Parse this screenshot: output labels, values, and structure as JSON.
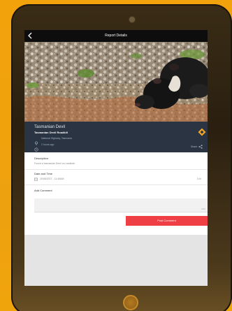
{
  "topbar": {
    "back_icon": "chevron-left-icon",
    "title": "Report Details"
  },
  "report": {
    "species": "Tasmanian Devil",
    "category": "Tasmanian Devil Roadkill",
    "location": "National Highway, Tasmania",
    "time_ago": "2 hours ago",
    "share_label": "Share",
    "warning_color": "#f5a623"
  },
  "description": {
    "label": "Description",
    "value": "Found a tasmanian Devil on roadside."
  },
  "datetime": {
    "label": "Date and Time",
    "value": "20/08/2017 - 11:45AM",
    "edit_label": "Edit"
  },
  "comments": {
    "label": "Add Comment",
    "char_count": "0/50",
    "post_label": "Post Comment",
    "post_color": "#ee3f44"
  }
}
